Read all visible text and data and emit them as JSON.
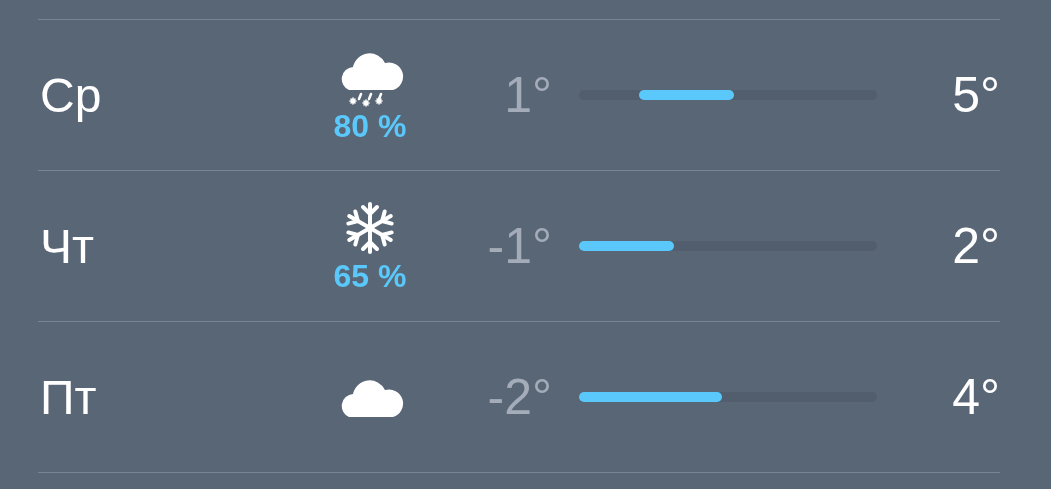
{
  "days": [
    {
      "day": "Ср",
      "kind": "sleet",
      "precipitation": "80 %",
      "low": "1°",
      "high": "5°",
      "level": 0.32
    },
    {
      "day": "Чт",
      "kind": "snow",
      "precipitation": "65 %",
      "low": "-1°",
      "high": "2°",
      "level": 0.32
    },
    {
      "day": "Пт",
      "kind": "cloudy",
      "low": "-2°",
      "high": "4°",
      "level": 0.48
    }
  ]
}
